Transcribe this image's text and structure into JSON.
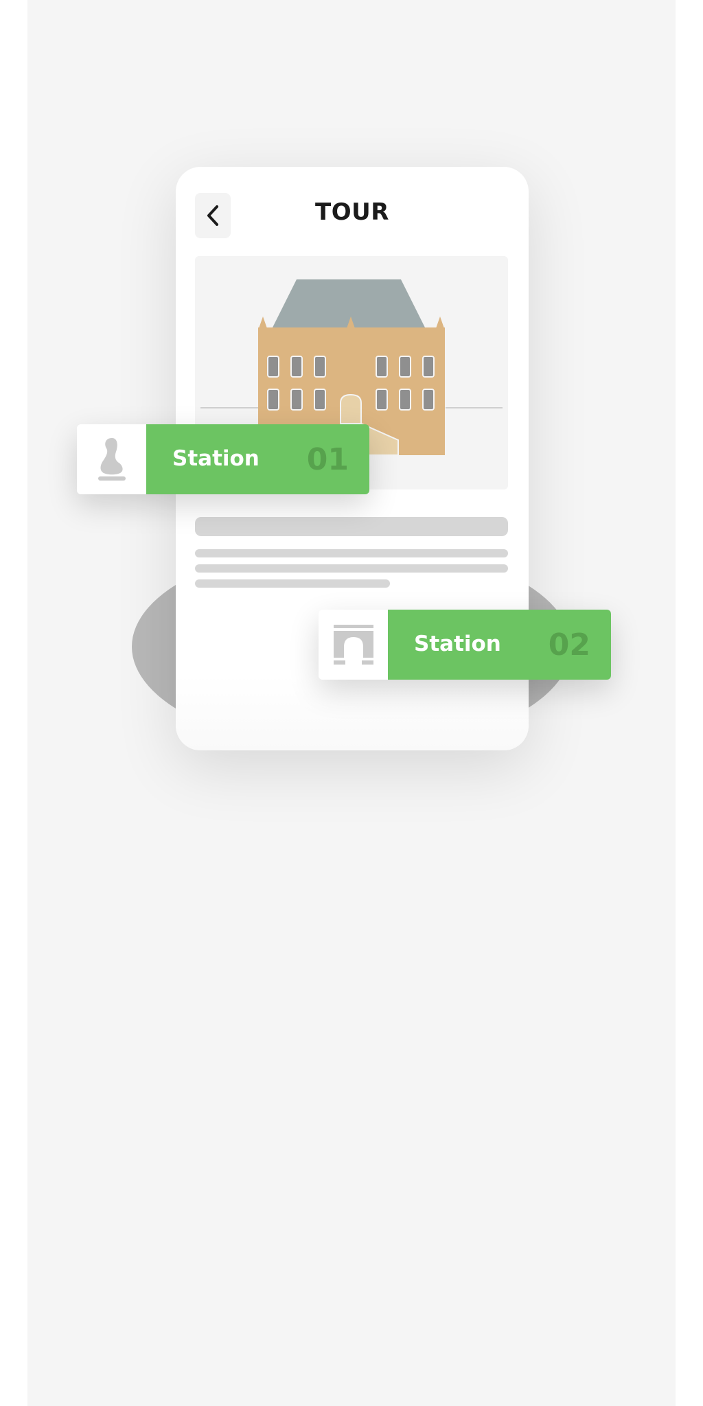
{
  "screen": {
    "title": "TOUR",
    "back_icon": "chevron-left-icon"
  },
  "hero": {
    "image": "building-illustration",
    "colors": {
      "roof": "#9eaaab",
      "facade": "#dcb581",
      "window": "#8f8f8f",
      "door": "#e7d1a8"
    }
  },
  "stations": [
    {
      "label": "Station",
      "number": "01",
      "icon": "statue-icon"
    },
    {
      "label": "Station",
      "number": "02",
      "icon": "arch-icon"
    }
  ],
  "colors": {
    "accent": "#6cc462",
    "accent_dark": "#57a24d",
    "background": "#f5f5f5",
    "skeleton": "#d6d6d6"
  }
}
